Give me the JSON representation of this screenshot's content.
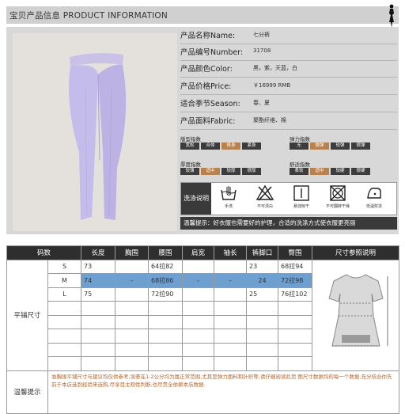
{
  "header": {
    "title": "宝贝产品信息 PRODUCT INFORMATION",
    "icon": "woman-silhouette-icon"
  },
  "product": {
    "info_rows": [
      {
        "label": "产品名称Name:",
        "value": "七分裤"
      },
      {
        "label": "产品编号Number:",
        "value": "31708"
      },
      {
        "label": "产品颜色Color:",
        "value": "黑，紫，天蓝，白"
      },
      {
        "label": "产品价格Price:",
        "value": "￥16999 RMB"
      },
      {
        "label": "适合季节Season:",
        "value": "春、夏"
      },
      {
        "label": "产品面料Fabric:",
        "value": "聚酯纤维、棉"
      }
    ],
    "indicators": [
      {
        "label": "版型指数",
        "options": [
          "宽松",
          "合体",
          "修身",
          "紧身"
        ],
        "selected": 2
      },
      {
        "label": "弹力指数",
        "options": [
          "无",
          "微弹",
          "较弹",
          "很弹"
        ],
        "selected": 1
      },
      {
        "label": "厚度指数",
        "options": [
          "较薄",
          "适中",
          "较厚",
          "很厚"
        ],
        "selected": 1
      },
      {
        "label": "舒适指数",
        "options": [
          "柔软",
          "适中",
          "较硬",
          "很硬"
        ],
        "selected": 1
      }
    ],
    "wash_label": "洗涤说明",
    "wash_items": [
      {
        "icon": "hand-wash-icon",
        "caption": "手洗"
      },
      {
        "icon": "no-bleach-icon",
        "caption": "不可漂白"
      },
      {
        "icon": "hang-dry-icon",
        "caption": "悬挂晾干"
      },
      {
        "icon": "no-tumble-dry-icon",
        "caption": "不可翻转干燥"
      },
      {
        "icon": "low-iron-icon",
        "caption": "低温熨烫"
      }
    ],
    "tip": "温馨提示：好衣服也需要好的护理，合适的洗涤方式使衣服更亮丽"
  },
  "size_table": {
    "headers": [
      "码数",
      "长度",
      "胸围",
      "腰围",
      "肩宽",
      "袖长",
      "裤脚口",
      "臀围",
      "尺寸参照说明"
    ],
    "side_label": "平铺尺寸",
    "rows": [
      {
        "size": "S",
        "length": "73",
        "chest": "",
        "waist": "64拉82",
        "shoulder": "",
        "sleeve": "",
        "hem": "23",
        "hip": "68拉94"
      },
      {
        "size": "M",
        "length": "74",
        "chest": "-",
        "waist": "68拉86",
        "shoulder": "-",
        "sleeve": "-",
        "hem": "24",
        "hip": "72拉98"
      },
      {
        "size": "L",
        "length": "75",
        "chest": "",
        "waist": "72拉90",
        "shoulder": "",
        "sleeve": "",
        "hem": "25",
        "hip": "76拉102"
      }
    ],
    "highlight_row": 1,
    "note_label": "温馨提示",
    "note_text": "准胸围平铺尺寸与建议均仅供参考,误差在1-2公分均为属正常范围,尤其是弹力面料和针织等,请仔细阅读此页 图尺寸数据均的每一个数据,充分结合你先前于本店选到经验来选购,尽享目主观性判断,也尽责全依赖本店数据."
  },
  "colors": {
    "accent_highlight": "#6d9fd0",
    "selected_indicator": "#b8824e",
    "dark": "#2e2e2e"
  }
}
